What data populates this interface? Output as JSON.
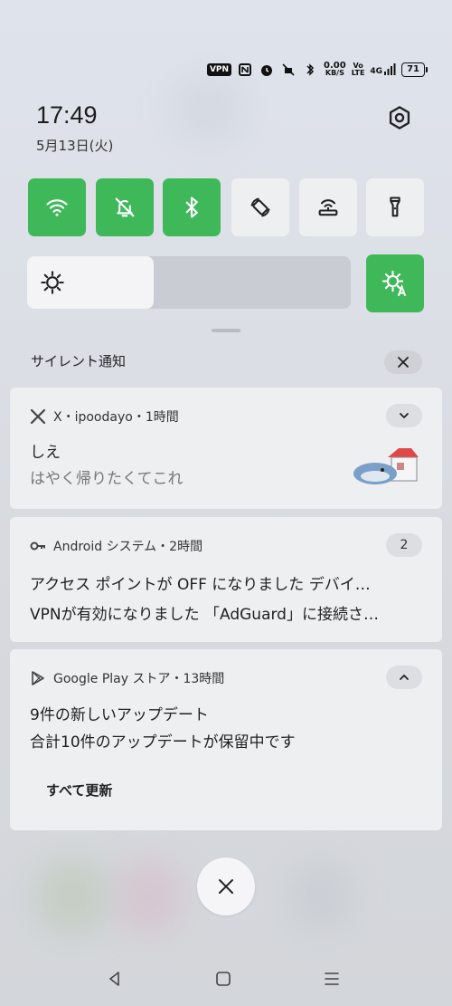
{
  "status_bar": {
    "vpn": "VPN",
    "net_speed_value": "0.00",
    "net_speed_unit": "KB/S",
    "volte_top": "Vo",
    "volte_bottom": "LTE",
    "network": "4G",
    "battery": "71"
  },
  "header": {
    "time": "17:49",
    "date": "5月13日(火)"
  },
  "quick_tiles": [
    {
      "name": "wifi",
      "state": "on"
    },
    {
      "name": "silent",
      "state": "on"
    },
    {
      "name": "bluetooth",
      "state": "on"
    },
    {
      "name": "auto-rotate",
      "state": "off"
    },
    {
      "name": "hotspot",
      "state": "off"
    },
    {
      "name": "flashlight",
      "state": "off"
    }
  ],
  "brightness": {
    "level": 0.39,
    "auto": true
  },
  "notifications": {
    "section_title": "サイレント通知",
    "items": [
      {
        "app": "X・ipoodayo・1時間",
        "title": "しえ",
        "text": "はやく帰りたくてこれ",
        "chip_icon": "chevron-down-icon"
      },
      {
        "app": "Android システム・2時間",
        "count": "2",
        "line1": "アクセス ポイントが OFF になりました デバイ…",
        "line2": "VPNが有効になりました 「AdGuard」に接続さ…"
      },
      {
        "app": "Google Play ストア・13時間",
        "title": "9件の新しいアップデート",
        "text": "合計10件のアップデートが保留中です",
        "action": "すべて更新",
        "chip_icon": "chevron-up-icon"
      }
    ]
  },
  "colors": {
    "accent_green": "#3fb85a",
    "tile_off": "#eeeff1",
    "card_bg": "#eeeff1"
  }
}
